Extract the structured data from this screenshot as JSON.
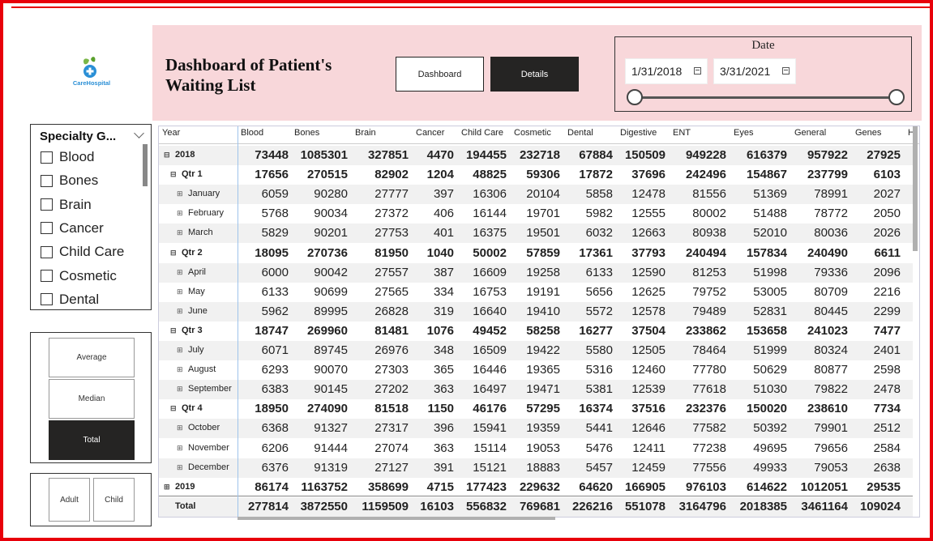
{
  "header": {
    "title_line1": "Dashboard of Patient's",
    "title_line2": "Waiting List",
    "logo_text": "CareHospital",
    "nav": {
      "dashboard": "Dashboard",
      "details": "Details"
    },
    "background_color": "#f8d7da"
  },
  "date_filter": {
    "title": "Date",
    "from": "1/31/2018",
    "to": "3/31/2021"
  },
  "specialty_filter": {
    "title": "Specialty G...",
    "items": [
      "Blood",
      "Bones",
      "Brain",
      "Cancer",
      "Child Care",
      "Cosmetic",
      "Dental"
    ]
  },
  "measure_buttons": {
    "average": "Average",
    "median": "Median",
    "total": "Total",
    "selected": "Total"
  },
  "age_buttons": {
    "adult": "Adult",
    "child": "Child"
  },
  "matrix": {
    "year_header": "Year",
    "columns": [
      "Blood",
      "Bones",
      "Brain",
      "Cancer",
      "Child Care",
      "Cosmetic",
      "Dental",
      "Digestive",
      "ENT",
      "Eyes",
      "General",
      "Genes",
      "H"
    ],
    "rows": [
      {
        "label": "2018",
        "level": 0,
        "bold": true,
        "expander": "⊟",
        "values": [
          "73448",
          "1085301",
          "327851",
          "4470",
          "194455",
          "232718",
          "67884",
          "150509",
          "949228",
          "616379",
          "957922",
          "27925"
        ]
      },
      {
        "label": "Qtr 1",
        "level": 1,
        "bold": true,
        "expander": "⊟",
        "values": [
          "17656",
          "270515",
          "82902",
          "1204",
          "48825",
          "59306",
          "17872",
          "37696",
          "242496",
          "154867",
          "237799",
          "6103"
        ]
      },
      {
        "label": "January",
        "level": 2,
        "bold": false,
        "expander": "⊞",
        "values": [
          "6059",
          "90280",
          "27777",
          "397",
          "16306",
          "20104",
          "5858",
          "12478",
          "81556",
          "51369",
          "78991",
          "2027"
        ]
      },
      {
        "label": "February",
        "level": 2,
        "bold": false,
        "expander": "⊞",
        "values": [
          "5768",
          "90034",
          "27372",
          "406",
          "16144",
          "19701",
          "5982",
          "12555",
          "80002",
          "51488",
          "78772",
          "2050"
        ]
      },
      {
        "label": "March",
        "level": 2,
        "bold": false,
        "expander": "⊞",
        "values": [
          "5829",
          "90201",
          "27753",
          "401",
          "16375",
          "19501",
          "6032",
          "12663",
          "80938",
          "52010",
          "80036",
          "2026"
        ]
      },
      {
        "label": "Qtr 2",
        "level": 1,
        "bold": true,
        "expander": "⊟",
        "values": [
          "18095",
          "270736",
          "81950",
          "1040",
          "50002",
          "57859",
          "17361",
          "37793",
          "240494",
          "157834",
          "240490",
          "6611"
        ]
      },
      {
        "label": "April",
        "level": 2,
        "bold": false,
        "expander": "⊞",
        "values": [
          "6000",
          "90042",
          "27557",
          "387",
          "16609",
          "19258",
          "6133",
          "12590",
          "81253",
          "51998",
          "79336",
          "2096"
        ]
      },
      {
        "label": "May",
        "level": 2,
        "bold": false,
        "expander": "⊞",
        "values": [
          "6133",
          "90699",
          "27565",
          "334",
          "16753",
          "19191",
          "5656",
          "12625",
          "79752",
          "53005",
          "80709",
          "2216"
        ]
      },
      {
        "label": "June",
        "level": 2,
        "bold": false,
        "expander": "⊞",
        "values": [
          "5962",
          "89995",
          "26828",
          "319",
          "16640",
          "19410",
          "5572",
          "12578",
          "79489",
          "52831",
          "80445",
          "2299"
        ]
      },
      {
        "label": "Qtr 3",
        "level": 1,
        "bold": true,
        "expander": "⊟",
        "values": [
          "18747",
          "269960",
          "81481",
          "1076",
          "49452",
          "58258",
          "16277",
          "37504",
          "233862",
          "153658",
          "241023",
          "7477"
        ]
      },
      {
        "label": "July",
        "level": 2,
        "bold": false,
        "expander": "⊞",
        "values": [
          "6071",
          "89745",
          "26976",
          "348",
          "16509",
          "19422",
          "5580",
          "12505",
          "78464",
          "51999",
          "80324",
          "2401"
        ]
      },
      {
        "label": "August",
        "level": 2,
        "bold": false,
        "expander": "⊞",
        "values": [
          "6293",
          "90070",
          "27303",
          "365",
          "16446",
          "19365",
          "5316",
          "12460",
          "77780",
          "50629",
          "80877",
          "2598"
        ]
      },
      {
        "label": "September",
        "level": 2,
        "bold": false,
        "expander": "⊞",
        "values": [
          "6383",
          "90145",
          "27202",
          "363",
          "16497",
          "19471",
          "5381",
          "12539",
          "77618",
          "51030",
          "79822",
          "2478"
        ]
      },
      {
        "label": "Qtr 4",
        "level": 1,
        "bold": true,
        "expander": "⊟",
        "values": [
          "18950",
          "274090",
          "81518",
          "1150",
          "46176",
          "57295",
          "16374",
          "37516",
          "232376",
          "150020",
          "238610",
          "7734"
        ]
      },
      {
        "label": "October",
        "level": 2,
        "bold": false,
        "expander": "⊞",
        "values": [
          "6368",
          "91327",
          "27317",
          "396",
          "15941",
          "19359",
          "5441",
          "12646",
          "77582",
          "50392",
          "79901",
          "2512"
        ]
      },
      {
        "label": "November",
        "level": 2,
        "bold": false,
        "expander": "⊞",
        "values": [
          "6206",
          "91444",
          "27074",
          "363",
          "15114",
          "19053",
          "5476",
          "12411",
          "77238",
          "49695",
          "79656",
          "2584"
        ]
      },
      {
        "label": "December",
        "level": 2,
        "bold": false,
        "expander": "⊞",
        "values": [
          "6376",
          "91319",
          "27127",
          "391",
          "15121",
          "18883",
          "5457",
          "12459",
          "77556",
          "49933",
          "79053",
          "2638"
        ]
      },
      {
        "label": "2019",
        "level": 0,
        "bold": true,
        "expander": "⊞",
        "values": [
          "86174",
          "1163752",
          "358699",
          "4715",
          "177423",
          "229632",
          "64620",
          "166905",
          "976103",
          "614622",
          "1012051",
          "29535"
        ]
      },
      {
        "label": "Total",
        "level": 0,
        "bold": true,
        "expander": "",
        "values": [
          "277814",
          "3872550",
          "1159509",
          "16103",
          "556832",
          "769681",
          "226216",
          "551078",
          "3164796",
          "2018385",
          "3461164",
          "109024"
        ]
      }
    ]
  },
  "colors": {
    "border": "#e8000b",
    "header_band": "#f8d7da",
    "selected_button": "#252423",
    "row_alt": "#f1f1f1"
  }
}
